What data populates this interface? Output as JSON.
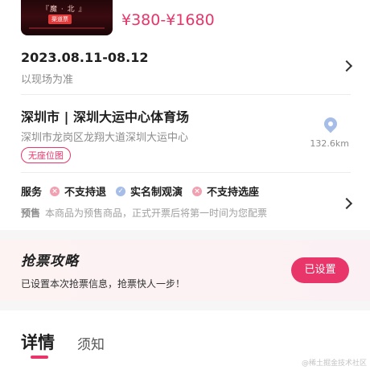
{
  "header": {
    "poster_text": "『魔 · 北 』",
    "poster_badge": "渠道票",
    "price_range": "¥380-¥1680"
  },
  "date": {
    "value": "2023.08.11-08.12",
    "note": "以现场为准"
  },
  "venue": {
    "name": "深圳市 | 深圳大运中心体育场",
    "address": "深圳市龙岗区龙翔大道深圳大运中心",
    "seat_map_tag": "无座位图",
    "distance": "132.6km"
  },
  "service": {
    "label": "服务",
    "items": [
      {
        "text": "不支持退",
        "status": "no"
      },
      {
        "text": "实名制观演",
        "status": "ok"
      },
      {
        "text": "不支持选座",
        "status": "no"
      }
    ],
    "presale_label": "预售",
    "presale_text": "本商品为预售商品，正式开票后将第一时间为您配票"
  },
  "strategy": {
    "title": "抢票攻略",
    "desc": "已设置本次抢票信息，抢票快人一步！",
    "button": "已设置"
  },
  "tabs": [
    {
      "label": "详情",
      "active": true
    },
    {
      "label": "须知",
      "active": false
    }
  ],
  "watermark": "@稀土掘金技术社区",
  "colors": {
    "accent": "#e8356a",
    "muted": "#8c8c8c",
    "pin": "#a6bde8"
  }
}
